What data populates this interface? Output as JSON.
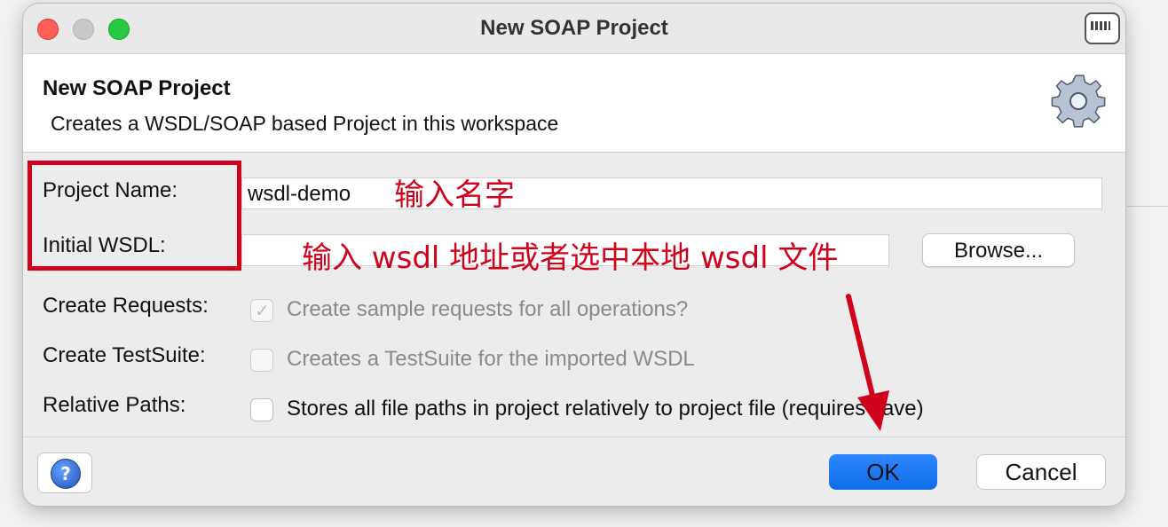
{
  "window": {
    "title": "New SOAP Project"
  },
  "header": {
    "title": "New SOAP Project",
    "subtitle": "Creates a WSDL/SOAP based Project in this workspace"
  },
  "form": {
    "project_name": {
      "label": "Project Name:",
      "value": "wsdl-demo"
    },
    "initial_wsdl": {
      "label": "Initial WSDL:",
      "value": "",
      "browse_label": "Browse..."
    },
    "create_requests": {
      "label": "Create Requests:",
      "checkbox_label": "Create sample requests for all operations?",
      "checked": true,
      "enabled": false
    },
    "create_testsuite": {
      "label": "Create TestSuite:",
      "checkbox_label": "Creates a TestSuite for the imported WSDL",
      "checked": false,
      "enabled": false
    },
    "relative_paths": {
      "label": "Relative Paths:",
      "checkbox_label": "Stores all file paths in project relatively to project file (requires save)",
      "checked": false,
      "enabled": true
    }
  },
  "footer": {
    "ok_label": "OK",
    "cancel_label": "Cancel"
  },
  "annotations": {
    "enter_name": "输入名字",
    "enter_wsdl": "输入 wsdl 地址或者选中本地 wsdl 文件",
    "color": "#d0021b"
  },
  "colors": {
    "accent": "#1a73e8",
    "annotation": "#d0021b"
  }
}
